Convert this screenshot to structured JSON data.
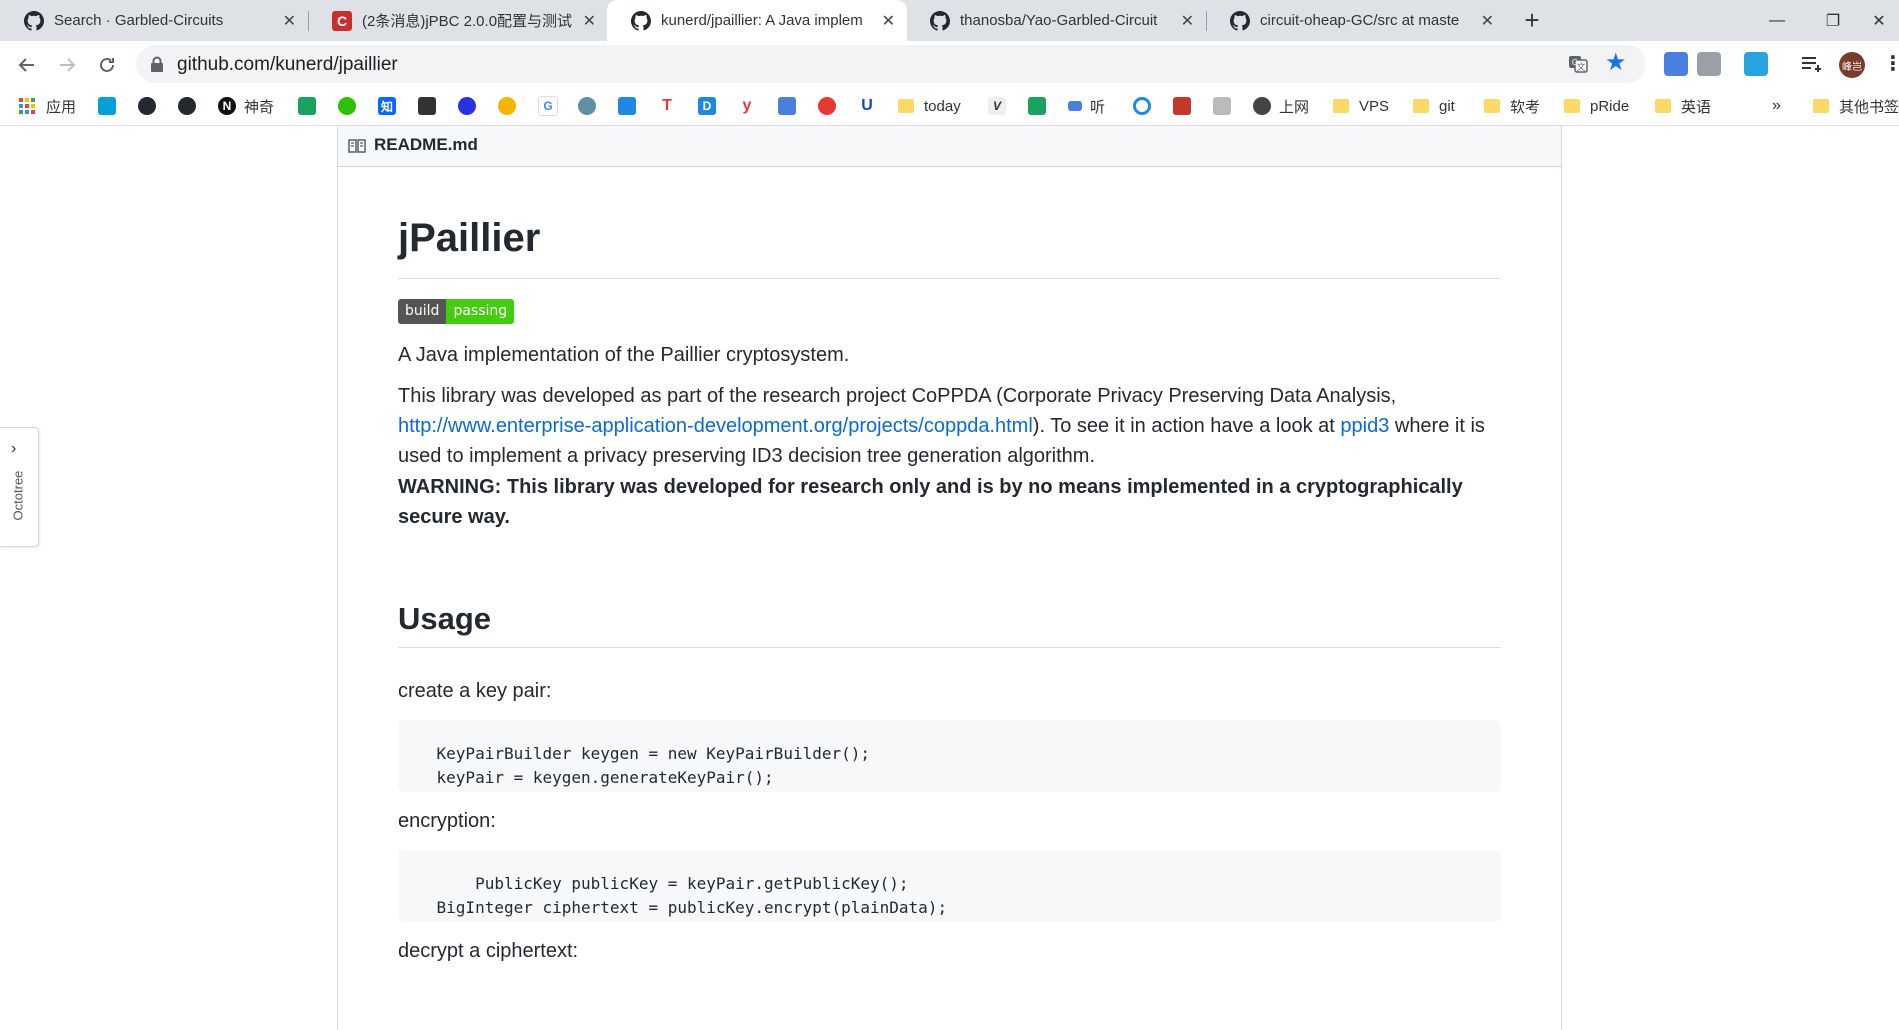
{
  "browser": {
    "tabs": [
      {
        "title": "Search · Garbled-Circuits",
        "icon": "github-icon",
        "active": false
      },
      {
        "title": "(2条消息)jPBC 2.0.0配置与测试",
        "icon": "csdn-icon",
        "active": false
      },
      {
        "title": "kunerd/jpaillier: A Java implem",
        "icon": "github-icon",
        "active": true
      },
      {
        "title": "thanosba/Yao-Garbled-Circuit",
        "icon": "github-icon",
        "active": false
      },
      {
        "title": "circuit-oheap-GC/src at maste",
        "icon": "github-icon",
        "active": false
      }
    ],
    "close_glyph": "✕",
    "new_tab_glyph": "+",
    "window": {
      "minimize": "—",
      "restore": "❐",
      "close": "✕"
    },
    "url": "github.com/kunerd/jpaillier",
    "avatar_text": "峰岂",
    "bookmarks": {
      "apps": "应用",
      "shenqi": "神奇",
      "today": "today",
      "ting": "听",
      "shangwang": "上网",
      "vps": "VPS",
      "git": "git",
      "ruankao": "软考",
      "pride": "pRide",
      "yingyu": "英语",
      "more": "»",
      "other": "其他书签"
    }
  },
  "readme": {
    "filename": "README.md",
    "title": "jPaillier",
    "badge": {
      "left": "build",
      "right": "passing"
    },
    "intro": "A Java implementation of the Paillier cryptosystem.",
    "p2_before": "This library was developed as part of the research project CoPPDA (Corporate Privacy Preserving Data Analysis, ",
    "p2_link1": "http://www.enterprise-application-development.org/projects/coppda.html",
    "p2_mid": "). To see it in action have a look at ",
    "p2_link2": "ppid3",
    "p2_after": " where it is used to implement a privacy preserving ID3 decision tree generation algorithm.",
    "warning": "WARNING: This library was developed for research only and is by no means implemented in a cryptographically secure way.",
    "usage_heading": "Usage",
    "keypair_label": "create a key pair:",
    "keypair_code": "    KeyPairBuilder keygen = new KeyPairBuilder();\n    keyPair = keygen.generateKeyPair();",
    "encryption_label": "encryption:",
    "encryption_code": "        PublicKey publicKey = keyPair.getPublicKey();\n    BigInteger ciphertext = publicKey.encrypt(plainData);",
    "decrypt_label": "decrypt a ciphertext:"
  },
  "octotree": {
    "label": "Octotree",
    "chevron": "›"
  }
}
